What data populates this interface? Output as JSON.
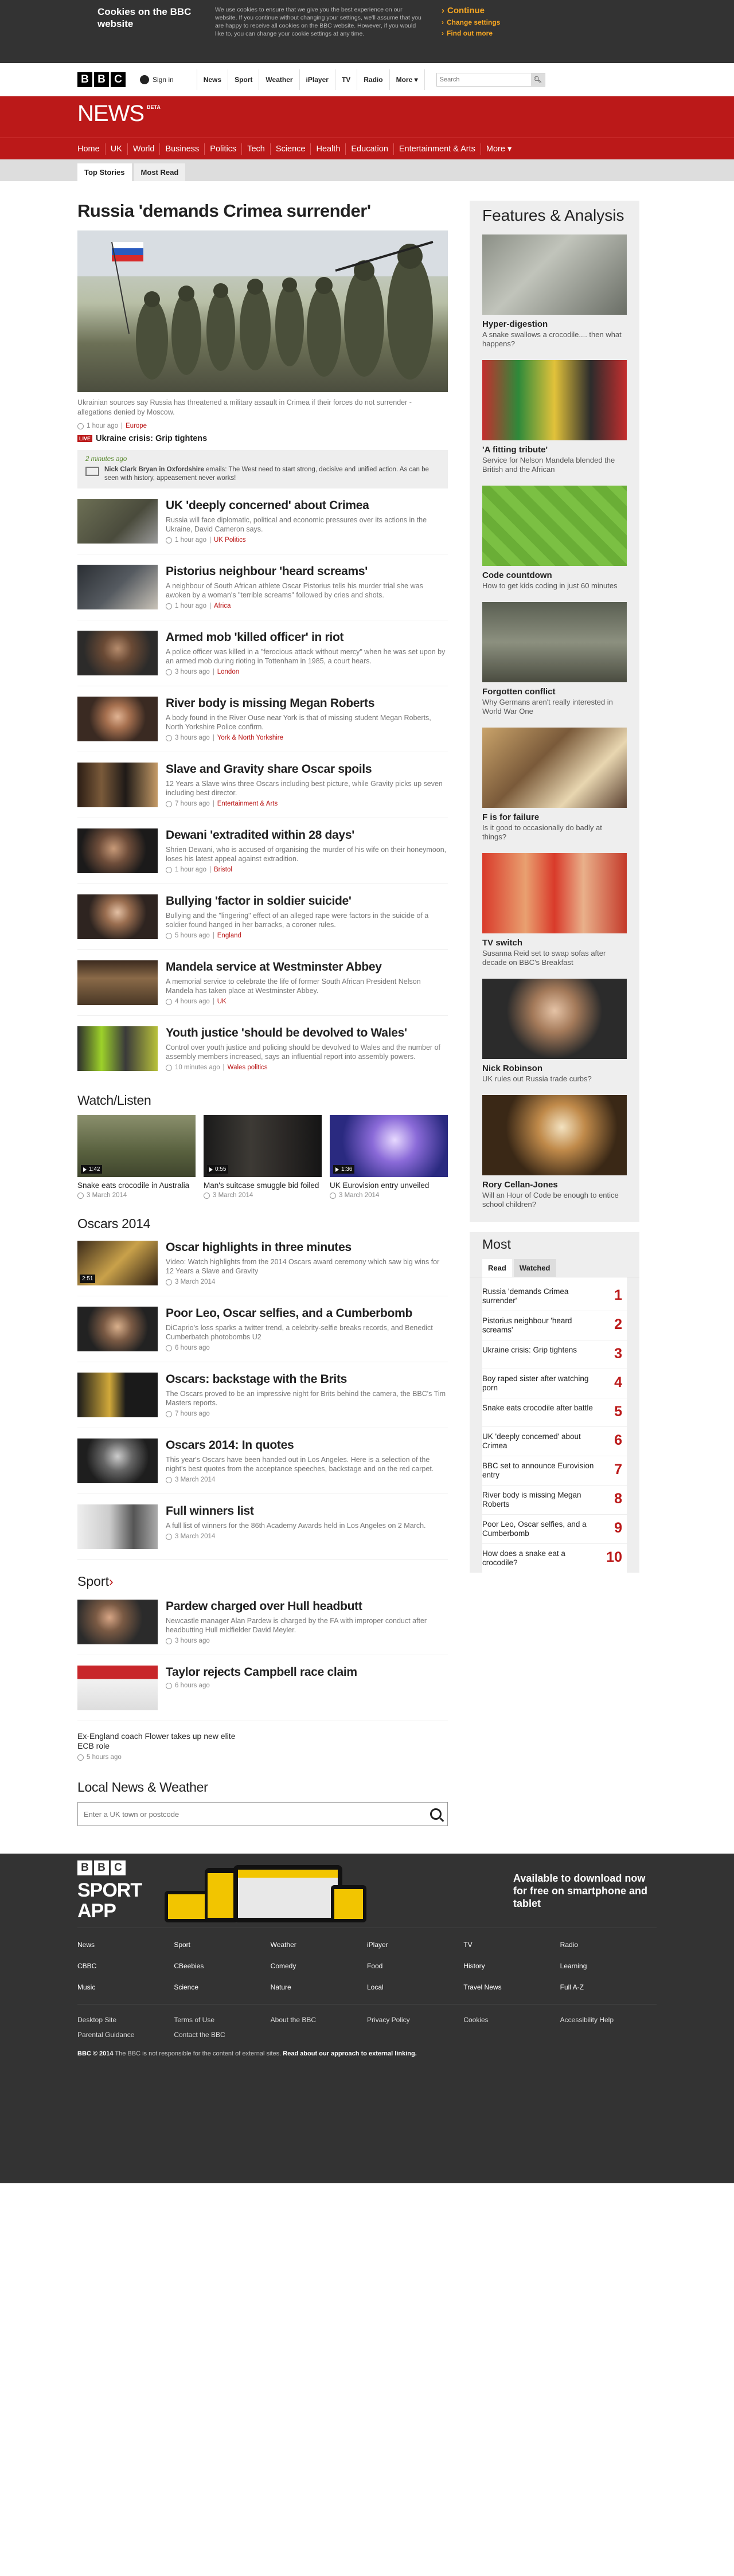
{
  "cookie": {
    "title": "Cookies on the BBC website",
    "body": "We use cookies to ensure that we give you the best experience on our website. If you continue without changing your settings, we'll assume that you are happy to receive all cookies on the BBC website. However, if you would like to, you can change your cookie settings at any time.",
    "continue": "Continue",
    "change": "Change settings",
    "find": "Find out more"
  },
  "blq": {
    "signin": "Sign in",
    "nav": [
      "News",
      "Sport",
      "Weather",
      "iPlayer",
      "TV",
      "Radio",
      "More"
    ],
    "search_placeholder": "Search"
  },
  "brand": {
    "news": "NEWS",
    "beta": "BETA"
  },
  "sections": [
    "Home",
    "UK",
    "World",
    "Business",
    "Politics",
    "Tech",
    "Science",
    "Health",
    "Education",
    "Entertainment & Arts",
    "More"
  ],
  "tabs": [
    "Top Stories",
    "Most Read"
  ],
  "lead": {
    "headline": "Russia 'demands Crimea surrender'",
    "caption": "Ukrainian sources say Russia has threatened a military assault in Crimea if their forces do not surrender - allegations denied by Moscow.",
    "time": "1 hour ago",
    "section": "Europe",
    "live_tag": "LIVE",
    "live_text": "Ukraine crisis: Grip tightens",
    "live_time": "2 minutes ago",
    "live_body_bold": "Nick Clark Bryan in Oxfordshire",
    "live_body": " emails: The West need to start strong, decisive and unified action. As can be seen with history, appeasement never works!"
  },
  "stories": [
    {
      "h": "UK 'deeply concerned' about Crimea",
      "p": "Russia will face diplomatic, political and economic pressures over its actions in the Ukraine, David Cameron says.",
      "t": "1 hour ago",
      "s": "UK Politics"
    },
    {
      "h": "Pistorius neighbour 'heard screams'",
      "p": "A neighbour of South African athlete Oscar Pistorius tells his murder trial she was awoken by a woman's \"terrible screams\" followed by cries and shots.",
      "t": "1 hour ago",
      "s": "Africa"
    },
    {
      "h": "Armed mob 'killed officer' in riot",
      "p": "A police officer was killed in a \"ferocious attack without mercy\" when he was set upon by an armed mob during rioting in Tottenham in 1985, a court hears.",
      "t": "3 hours ago",
      "s": "London"
    },
    {
      "h": "River body is missing Megan Roberts",
      "p": "A body found in the River Ouse near York is that of missing student Megan Roberts, North Yorkshire Police confirm.",
      "t": "3 hours ago",
      "s": "York & North Yorkshire"
    },
    {
      "h": "Slave and Gravity share Oscar spoils",
      "p": "12 Years a Slave wins three Oscars including best picture, while Gravity picks up seven including best director.",
      "t": "7 hours ago",
      "s": "Entertainment & Arts"
    },
    {
      "h": "Dewani 'extradited within 28 days'",
      "p": "Shrien Dewani, who is accused of organising the murder of his wife on their honeymoon, loses his latest appeal against extradition.",
      "t": "1 hour ago",
      "s": "Bristol"
    },
    {
      "h": "Bullying 'factor in soldier suicide'",
      "p": "Bullying and the \"lingering\" effect of an alleged rape were factors in the suicide of a soldier found hanged in her barracks, a coroner rules.",
      "t": "5 hours ago",
      "s": "England"
    },
    {
      "h": "Mandela service at Westminster Abbey",
      "p": "A memorial service to celebrate the life of former South African President Nelson Mandela has taken place at Westminster Abbey.",
      "t": "4 hours ago",
      "s": "UK"
    },
    {
      "h": "Youth justice 'should be devolved to Wales'",
      "p": "Control over youth justice and policing should be devolved to Wales and the number of assembly members increased, says an influential report into assembly powers.",
      "t": "10 minutes ago",
      "s": "Wales politics"
    }
  ],
  "watch": {
    "title": "Watch/Listen",
    "items": [
      {
        "h": "Snake eats crocodile in Australia",
        "d": "1:42",
        "t": "3 March 2014"
      },
      {
        "h": "Man's suitcase smuggle bid foiled",
        "d": "0:55",
        "t": "3 March 2014"
      },
      {
        "h": "UK Eurovision entry unveiled",
        "d": "1:36",
        "t": "3 March 2014"
      }
    ]
  },
  "oscars": {
    "title": "Oscars 2014",
    "items": [
      {
        "h": "Oscar highlights in three minutes",
        "p": "Video: Watch highlights from the 2014 Oscars award ceremony which saw big wins for 12 Years a Slave and Gravity",
        "t": "3 March 2014",
        "d": "2:51"
      },
      {
        "h": "Poor Leo, Oscar selfies, and a Cumberbomb",
        "p": "DiCaprio's loss sparks a twitter trend, a celebrity-selfie breaks records, and Benedict Cumberbatch photobombs U2",
        "t": "6 hours ago"
      },
      {
        "h": "Oscars: backstage with the Brits",
        "p": "The Oscars proved to be an impressive night for Brits behind the camera, the BBC's Tim Masters reports.",
        "t": "7 hours ago"
      },
      {
        "h": "Oscars 2014: In quotes",
        "p": "This year's Oscars have been handed out in Los Angeles. Here is a selection of the night's best quotes from the acceptance speeches, backstage and on the red carpet.",
        "t": "3 March 2014"
      },
      {
        "h": "Full winners list",
        "p": "A full list of winners for the 86th Academy Awards held in Los Angeles on 2 March.",
        "t": "3 March 2014"
      }
    ]
  },
  "sport": {
    "title": "Sport",
    "arrow": "›",
    "items": [
      {
        "h": "Pardew charged over Hull headbutt",
        "p": "Newcastle manager Alan Pardew is charged by the FA with improper conduct after headbutting Hull midfielder David Meyler.",
        "t": "3 hours ago"
      },
      {
        "h": "Taylor rejects Campbell race claim",
        "p": "",
        "t": "6 hours ago"
      }
    ],
    "plain": "Ex-England coach Flower takes up new elite ECB role",
    "plain_t": "5 hours ago"
  },
  "local": {
    "title": "Local News & Weather",
    "placeholder": "Enter a UK town or postcode"
  },
  "features": {
    "title": "Features & Analysis",
    "items": [
      {
        "h": "Hyper-digestion",
        "p": "A snake swallows a crocodile.... then what happens?"
      },
      {
        "h": "'A fitting tribute'",
        "p": "Service for Nelson Mandela blended the British and the African"
      },
      {
        "h": "Code countdown",
        "p": "How to get kids coding in just 60 minutes"
      },
      {
        "h": "Forgotten conflict",
        "p": "Why Germans aren't really interested in World War One"
      },
      {
        "h": "F is for failure",
        "p": "Is it good to occasionally do badly at things?"
      },
      {
        "h": "TV switch",
        "p": "Susanna Reid set to swap sofas after decade on BBC's Breakfast"
      },
      {
        "h": "Nick Robinson",
        "p": "UK rules out Russia trade curbs?"
      },
      {
        "h": "Rory Cellan-Jones",
        "p": "Will an Hour of Code be enough to entice school children?"
      }
    ]
  },
  "most": {
    "title": "Most",
    "tabs": [
      "Read",
      "Watched"
    ],
    "items": [
      {
        "t": "Russia 'demands Crimea surrender'",
        "n": "1"
      },
      {
        "t": "Pistorius neighbour 'heard screams'",
        "n": "2"
      },
      {
        "t": "Ukraine crisis: Grip tightens",
        "n": "3"
      },
      {
        "t": "Boy raped sister after watching porn",
        "n": "4"
      },
      {
        "t": "Snake eats crocodile after battle",
        "n": "5"
      },
      {
        "t": "UK 'deeply concerned' about Crimea",
        "n": "6"
      },
      {
        "t": "BBC set to announce Eurovision entry",
        "n": "7"
      },
      {
        "t": "River body is missing Megan Roberts",
        "n": "8"
      },
      {
        "t": "Poor Leo, Oscar selfies, and a Cumberbomb",
        "n": "9"
      },
      {
        "t": "How does a snake eat a crocodile?",
        "n": "10"
      }
    ]
  },
  "footer": {
    "sport": "SPORT",
    "app": "APP",
    "download": "Available to download now for free on smartphone and tablet",
    "nav": [
      "News",
      "Sport",
      "Weather",
      "iPlayer",
      "TV",
      "Radio",
      "CBBC",
      "CBeebies",
      "Comedy",
      "Food",
      "History",
      "Learning",
      "Music",
      "Science",
      "Nature",
      "Local",
      "Travel News",
      "Full A-Z"
    ],
    "legal": [
      "Desktop Site",
      "Terms of Use",
      "About the BBC",
      "Privacy Policy",
      "Cookies",
      "Accessibility Help",
      "Parental Guidance",
      "Contact the BBC"
    ],
    "copy_bold": "BBC © 2014",
    "copy": " The BBC is not responsible for the content of external sites.",
    "copy_link": "Read about our approach to external linking."
  }
}
